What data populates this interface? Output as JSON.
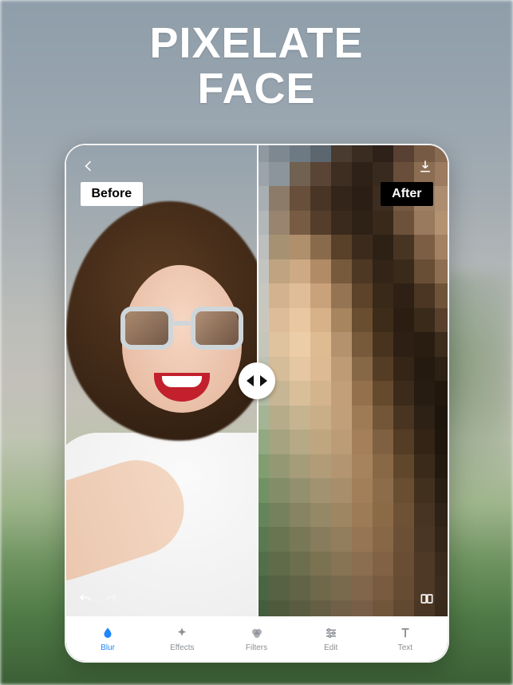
{
  "headline_line1": "PIXELATE",
  "headline_line2": "FACE",
  "labels": {
    "before": "Before",
    "after": "After"
  },
  "tabs": [
    {
      "id": "blur",
      "label": "Blur",
      "active": true
    },
    {
      "id": "effects",
      "label": "Effects",
      "active": false
    },
    {
      "id": "filters",
      "label": "Filters",
      "active": false
    },
    {
      "id": "edit",
      "label": "Edit",
      "active": false
    },
    {
      "id": "text",
      "label": "Text",
      "active": false
    }
  ],
  "colors": {
    "accent": "#1f87ff"
  },
  "pixel_palette": [
    "#8d99a3",
    "#7c8892",
    "#6d7a84",
    "#5a6670",
    "#4a3b2e",
    "#3b2c20",
    "#2e2118",
    "#5a4030",
    "#7a5a40",
    "#8c6a4e",
    "#9aa4ac",
    "#8b959d",
    "#73614e",
    "#5c4433",
    "#402d1f",
    "#2f2116",
    "#3a2a1d",
    "#6a4e38",
    "#8e6c50",
    "#a07a5c",
    "#a7afb4",
    "#8e7b66",
    "#6a4f38",
    "#4a3523",
    "#352518",
    "#2c1e13",
    "#3f2d1e",
    "#765a40",
    "#a07e60",
    "#b08c6c",
    "#b2b7b8",
    "#9a846c",
    "#7a5c40",
    "#563d27",
    "#3c2a1b",
    "#2f2115",
    "#3a2919",
    "#6e5238",
    "#9c7a5a",
    "#b6916e",
    "#bcbfbd",
    "#a8926f",
    "#b38e68",
    "#8c6b48",
    "#5a4026",
    "#3e2b1a",
    "#2e2013",
    "#4a3420",
    "#7e5e40",
    "#a6805e",
    "#c3c4be",
    "#c3a37c",
    "#d0a97e",
    "#b58a60",
    "#7a5a38",
    "#4e3820",
    "#332415",
    "#3c2a18",
    "#6a4e32",
    "#916d4c",
    "#c8c7be",
    "#d6b38a",
    "#e2bd92",
    "#cda075",
    "#97744e",
    "#5e4326",
    "#3a2916",
    "#2f2013",
    "#4c3620",
    "#725436",
    "#c9c7bc",
    "#e0bd94",
    "#ecc79c",
    "#dbb083",
    "#aa845a",
    "#6c4e2c",
    "#402c18",
    "#2c1d10",
    "#3c2a18",
    "#5a402a",
    "#c6c5b8",
    "#e2c29a",
    "#efcda3",
    "#e3ba8c",
    "#b8916a",
    "#7a5a36",
    "#4a331c",
    "#2e1f12",
    "#2a1c10",
    "#3e2c1a",
    "#bfc2b0",
    "#d8bd96",
    "#e8c89e",
    "#e0b98c",
    "#c29a70",
    "#8a6842",
    "#563c22",
    "#362514",
    "#261a0e",
    "#2e2013",
    "#b3bda4",
    "#c9b690",
    "#dabf96",
    "#d7b488",
    "#c59e74",
    "#986f48",
    "#684a2a",
    "#3e2b18",
    "#281c10",
    "#22170c",
    "#a2b692",
    "#b8ac86",
    "#c8b48c",
    "#cdae82",
    "#c49f74",
    "#a27a50",
    "#765634",
    "#4a341e",
    "#2e2012",
    "#1e150b",
    "#8fab7e",
    "#a6a37c",
    "#b7a982",
    "#c2a67c",
    "#bf9c72",
    "#a87e54",
    "#82603c",
    "#563c22",
    "#342414",
    "#20160c",
    "#7e9f6c",
    "#94996f",
    "#a69c76",
    "#b49c74",
    "#b6966c",
    "#aa8258",
    "#8c6842",
    "#624628",
    "#3c2a18",
    "#241a0e",
    "#6e9360",
    "#828e64",
    "#94906a",
    "#a4926c",
    "#aa8e66",
    "#a67e54",
    "#906c46",
    "#6c4e2e",
    "#44301c",
    "#2a1e10",
    "#628656",
    "#748258",
    "#86845e",
    "#968862",
    "#a0865e",
    "#a07a52",
    "#8e6a44",
    "#705232",
    "#4a3420",
    "#302214",
    "#587a4c",
    "#68764e",
    "#787854",
    "#887c58",
    "#947e58",
    "#987450",
    "#8a6642",
    "#6e5032",
    "#4c3622",
    "#342616",
    "#507046",
    "#5e6c46",
    "#6c6e4a",
    "#7c724e",
    "#887450",
    "#8e6e4c",
    "#846240",
    "#6c4e32",
    "#503824",
    "#3a2a1a",
    "#486640",
    "#566240",
    "#626444",
    "#706848",
    "#7c6a4a",
    "#846648",
    "#7c5c3c",
    "#684c30",
    "#503824",
    "#3c2c1c",
    "#425e3a",
    "#4e5a3a",
    "#5a5c3e",
    "#665e42",
    "#726044",
    "#7a5e44",
    "#745638",
    "#62482e",
    "#4c3622",
    "#3a2a1a"
  ]
}
